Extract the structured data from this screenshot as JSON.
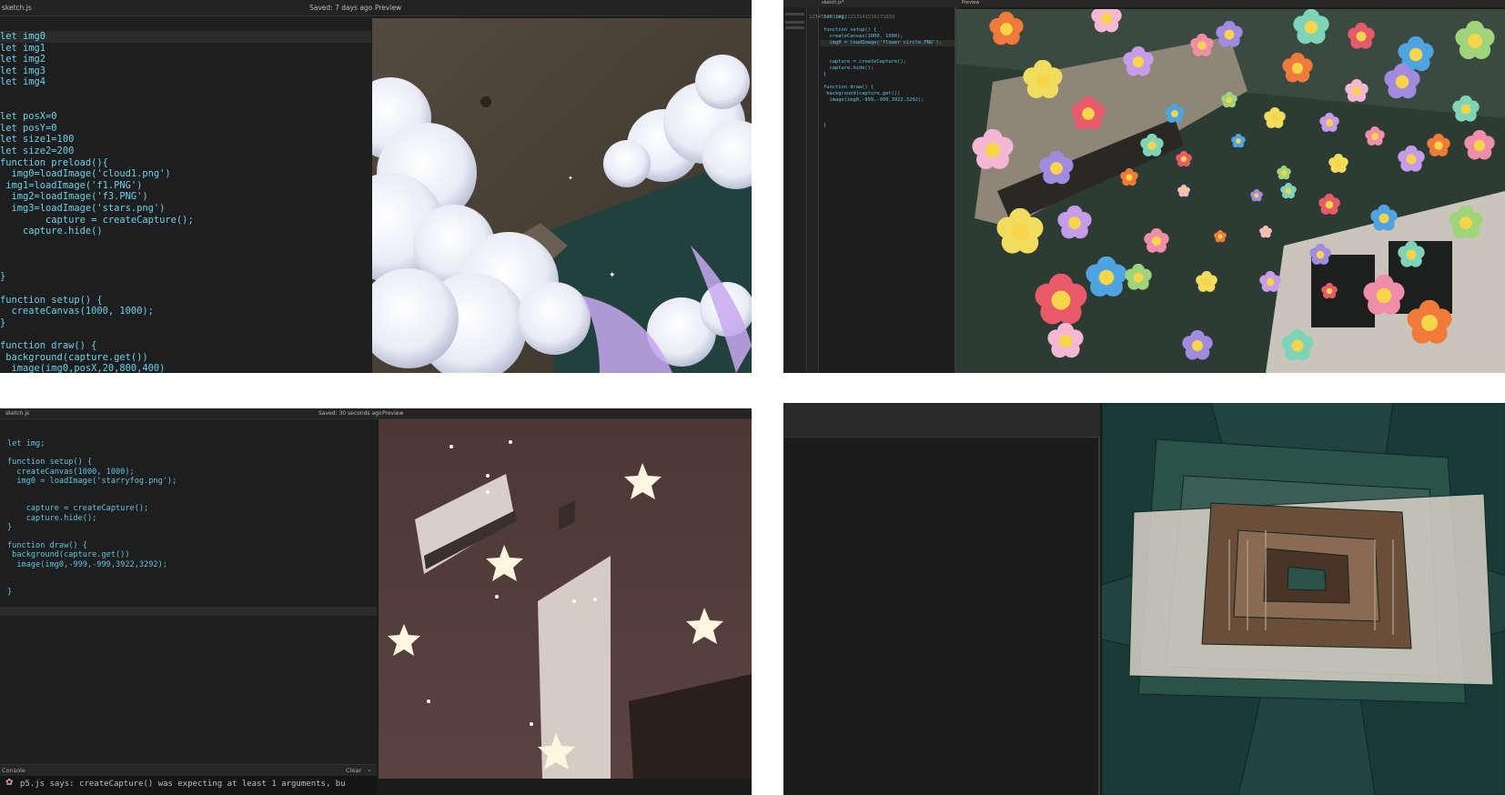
{
  "panels": {
    "top_left": {
      "file_tab": "sketch.js",
      "saved_status": "Saved: 7 days ago",
      "preview_label": "Preview",
      "code_lines": [
        "let img0",
        "let img1",
        "let img2",
        "let img3",
        "let img4",
        "",
        "",
        "let posX=0",
        "let posY=0",
        "let size1=100",
        "let size2=200",
        "function preload(){",
        "  img0=loadImage('cloud1.png')",
        " img1=loadImage('f1.PNG')",
        "  img2=loadImage('f3.PNG')",
        "  img3=loadImage('stars.png')",
        "        capture = createCapture();",
        "    capture.hide()",
        "",
        "",
        "",
        "}",
        "",
        "function setup() {",
        "  createCanvas(1000, 1000);",
        "}",
        "",
        "function draw() {",
        " background(capture.get())",
        "  image(img0,posX,20,800,400)"
      ]
    },
    "top_right": {
      "file_tab": "sketch.js*",
      "preview_label": "Preview",
      "line_numbers": [
        "1",
        "2",
        "3",
        "4",
        "5",
        "6",
        "7",
        "8",
        "9",
        "10",
        "11",
        "12",
        "13",
        "14",
        "15",
        "16",
        "17",
        "18",
        "19"
      ],
      "code_lines": [
        "let img;",
        "",
        "function setup() {",
        "  createCanvas(1000, 1000);",
        "  img0 = loadImage('flower circle.PNG');",
        "",
        "",
        "  capture = createCapture();",
        "  capture.hide();",
        "}",
        "",
        "function draw() {",
        " background(capture.get())",
        "  image(img0,-999,-999,3922,3292);",
        "",
        "",
        "",
        "}",
        ""
      ]
    },
    "bottom_left": {
      "file_tab": "sketch.js",
      "saved_status": "Saved: 30 seconds ago",
      "preview_label": "Preview",
      "code_lines": [
        "let img;",
        "",
        "function setup() {",
        "  createCanvas(1000, 1000);",
        "  img0 = loadImage('starryfog.png');",
        "",
        "",
        "    capture = createCapture();",
        "    capture.hide();",
        "}",
        "",
        "function draw() {",
        " background(capture.get())",
        "  image(img0,-999,-999,3922,3292);",
        "",
        "",
        "}"
      ],
      "console_label": "Console",
      "clear_label": "Clear",
      "console_message": "p5.js says: createCapture() was expecting at least 1 arguments, bu"
    }
  },
  "colors": {
    "editor_bg": "#1e1e1e",
    "code_text": "#5fc8e6",
    "chrome": "#232323"
  }
}
